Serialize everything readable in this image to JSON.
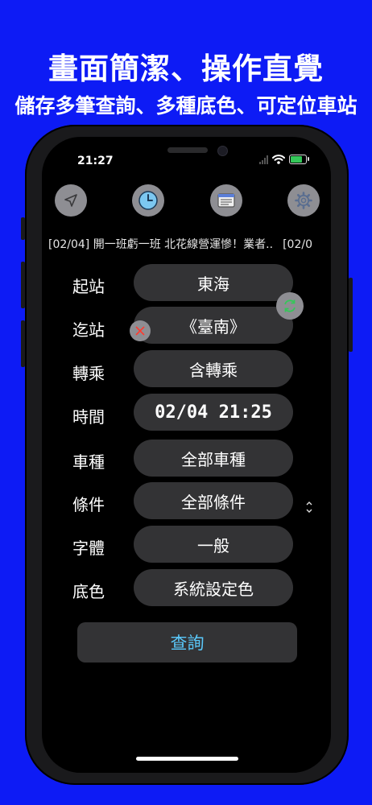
{
  "promo": {
    "headline": "畫面簡潔、操作直覺",
    "subheadline": "儲存多筆查詢、多種底色、可定位車站"
  },
  "status_bar": {
    "time": "21:27"
  },
  "toolbar": {
    "icons": [
      "location-arrow-icon",
      "clock-icon",
      "news-icon",
      "gear-icon"
    ]
  },
  "news_ticker": {
    "item": "[02/04] 開一班虧一班 北花線營運慘！業者..",
    "next_item": "[02/0"
  },
  "form": {
    "rows": [
      {
        "label": "起站",
        "value": "東海"
      },
      {
        "label": "迄站",
        "value": "《臺南》"
      },
      {
        "label": "轉乘",
        "value": "含轉乘"
      },
      {
        "label": "時間",
        "value": "02/04 21:25"
      },
      {
        "label": "車種",
        "value": "全部車種"
      },
      {
        "label": "條件",
        "value": "全部條件"
      },
      {
        "label": "字體",
        "value": "一般"
      },
      {
        "label": "底色",
        "value": "系統設定色"
      }
    ]
  },
  "query_button": {
    "label": "查詢"
  },
  "colors": {
    "background": "#0d1bf5",
    "pill": "#333335",
    "accent_link": "#5ac8fa",
    "swap_icon": "#34c759",
    "clear_icon": "#ff3b30",
    "icon_circle": "#8e8e93"
  }
}
